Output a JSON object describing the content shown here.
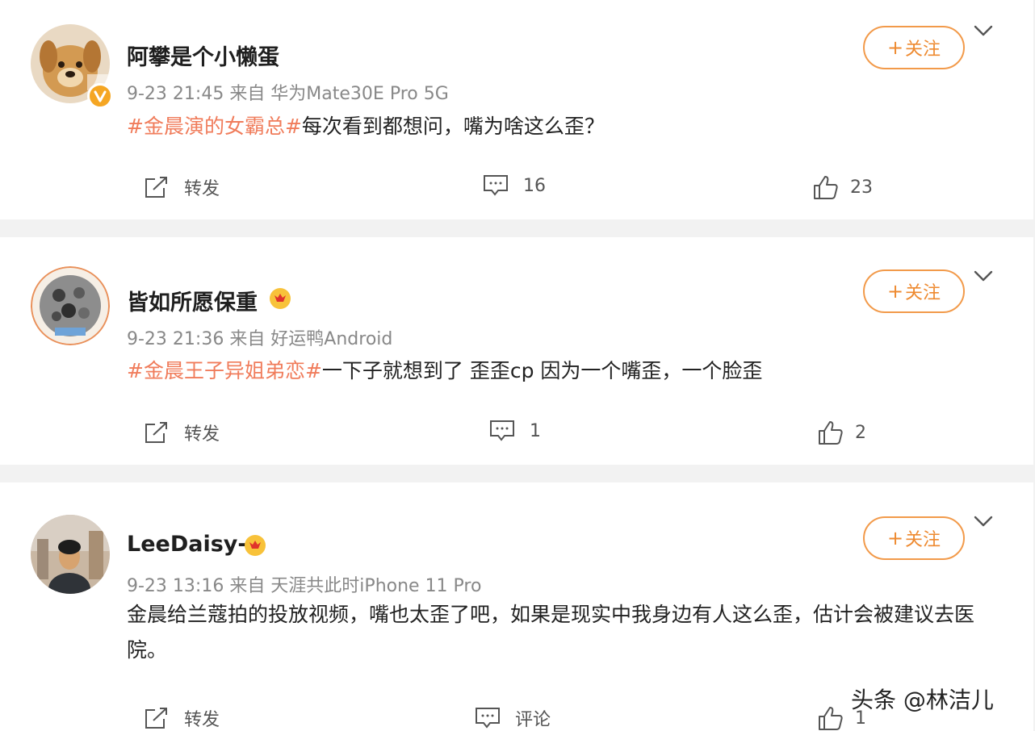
{
  "posts": [
    {
      "username": "阿攀是个小懒蛋",
      "meta": "9-23 21:45  来自 华为Mate30E Pro 5G",
      "hashtag": "#金晨演的女霸总#",
      "text": "每次看到都想问，嘴为啥这么歪？",
      "follow_label": "关注",
      "repost_label": "转发",
      "comment_count": "16",
      "like_count": "23",
      "badge": "v-badge"
    },
    {
      "username": "皆如所愿保重",
      "meta": "9-23 21:36  来自 好运鸭Android",
      "hashtag": "#金晨王子异姐弟恋#",
      "text": "一下子就想到了 歪歪cp 因为一个嘴歪，一个脸歪",
      "follow_label": "关注",
      "repost_label": "转发",
      "comment_count": "1",
      "like_count": "2",
      "badge": "vip-crown-icon"
    },
    {
      "username": "LeeDaisy-",
      "meta": "9-23 13:16  来自 天涯共此时iPhone 11 Pro",
      "hashtag": "",
      "text": "金晨给兰蔻拍的投放视频，嘴也太歪了吧，如果是现实中我身边有人这么歪，估计会被建议去医院。",
      "follow_label": "关注",
      "repost_label": "转发",
      "comment_label": "评论",
      "like_count": "1",
      "badge": "vip-crown-icon"
    }
  ],
  "watermark": "头条 @林洁儿",
  "colors": {
    "accent": "#ee8a30",
    "hashtag": "#f07c5b",
    "background": "#f2f2f2"
  }
}
